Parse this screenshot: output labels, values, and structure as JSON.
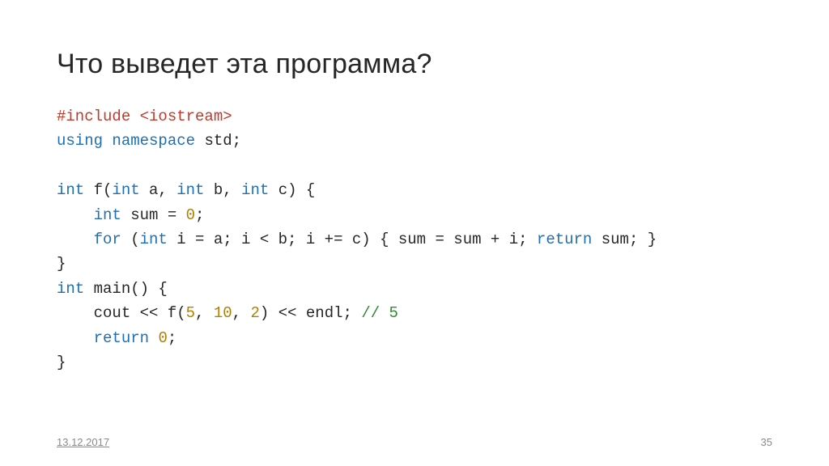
{
  "slide": {
    "title": "Что выведет эта программа?",
    "footer_date": "13.12.2017",
    "footer_page": "35"
  },
  "code": {
    "lines": [
      [
        {
          "t": "#include <iostream>",
          "c": "tok-pre"
        }
      ],
      [
        {
          "t": "using namespace ",
          "c": "tok-kw"
        },
        {
          "t": "std;",
          "c": "tok-plain"
        }
      ],
      [
        {
          "t": "",
          "c": "tok-plain"
        }
      ],
      [
        {
          "t": "int ",
          "c": "tok-kw"
        },
        {
          "t": "f(",
          "c": "tok-plain"
        },
        {
          "t": "int ",
          "c": "tok-kw"
        },
        {
          "t": "a, ",
          "c": "tok-plain"
        },
        {
          "t": "int ",
          "c": "tok-kw"
        },
        {
          "t": "b, ",
          "c": "tok-plain"
        },
        {
          "t": "int ",
          "c": "tok-kw"
        },
        {
          "t": "c) {",
          "c": "tok-plain"
        }
      ],
      [
        {
          "t": "    ",
          "c": "tok-plain"
        },
        {
          "t": "int ",
          "c": "tok-kw"
        },
        {
          "t": "sum = ",
          "c": "tok-plain"
        },
        {
          "t": "0",
          "c": "tok-num"
        },
        {
          "t": ";",
          "c": "tok-plain"
        }
      ],
      [
        {
          "t": "    ",
          "c": "tok-plain"
        },
        {
          "t": "for ",
          "c": "tok-kw"
        },
        {
          "t": "(",
          "c": "tok-plain"
        },
        {
          "t": "int ",
          "c": "tok-kw"
        },
        {
          "t": "i = a; i < b; i += c) { sum = sum + i; ",
          "c": "tok-plain"
        },
        {
          "t": "return ",
          "c": "tok-kw"
        },
        {
          "t": "sum; }",
          "c": "tok-plain"
        }
      ],
      [
        {
          "t": "}",
          "c": "tok-plain"
        }
      ],
      [
        {
          "t": "int ",
          "c": "tok-kw"
        },
        {
          "t": "main() {",
          "c": "tok-plain"
        }
      ],
      [
        {
          "t": "    cout << f(",
          "c": "tok-plain"
        },
        {
          "t": "5",
          "c": "tok-num"
        },
        {
          "t": ", ",
          "c": "tok-plain"
        },
        {
          "t": "10",
          "c": "tok-num"
        },
        {
          "t": ", ",
          "c": "tok-plain"
        },
        {
          "t": "2",
          "c": "tok-num"
        },
        {
          "t": ") << endl; ",
          "c": "tok-plain"
        },
        {
          "t": "// 5",
          "c": "tok-comm"
        }
      ],
      [
        {
          "t": "    ",
          "c": "tok-plain"
        },
        {
          "t": "return ",
          "c": "tok-kw"
        },
        {
          "t": "0",
          "c": "tok-num"
        },
        {
          "t": ";",
          "c": "tok-plain"
        }
      ],
      [
        {
          "t": "}",
          "c": "tok-plain"
        }
      ]
    ]
  }
}
